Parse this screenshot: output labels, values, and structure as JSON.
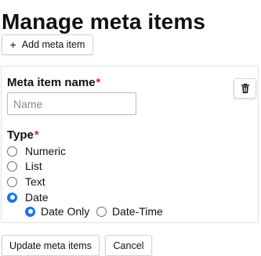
{
  "page": {
    "title": "Manage meta items"
  },
  "toolbar": {
    "add_button_label": "Add meta item",
    "add_icon": "+"
  },
  "meta_item": {
    "name_label": "Meta item name",
    "required_marker": "*",
    "name_value": "",
    "name_placeholder": "Name",
    "delete_icon": "trash-icon",
    "type_label": "Type",
    "type_options": [
      {
        "label": "Numeric",
        "selected": false
      },
      {
        "label": "List",
        "selected": false
      },
      {
        "label": "Text",
        "selected": false
      },
      {
        "label": "Date",
        "selected": true
      }
    ],
    "date_options": [
      {
        "label": "Date Only",
        "selected": true
      },
      {
        "label": "Date-Time",
        "selected": false
      }
    ]
  },
  "footer": {
    "update_button_label": "Update meta items",
    "cancel_button_label": "Cancel"
  },
  "colors": {
    "accent": "#1a73e8",
    "required": "#d8232a",
    "text": "#111111",
    "border": "#d4d4d4"
  }
}
